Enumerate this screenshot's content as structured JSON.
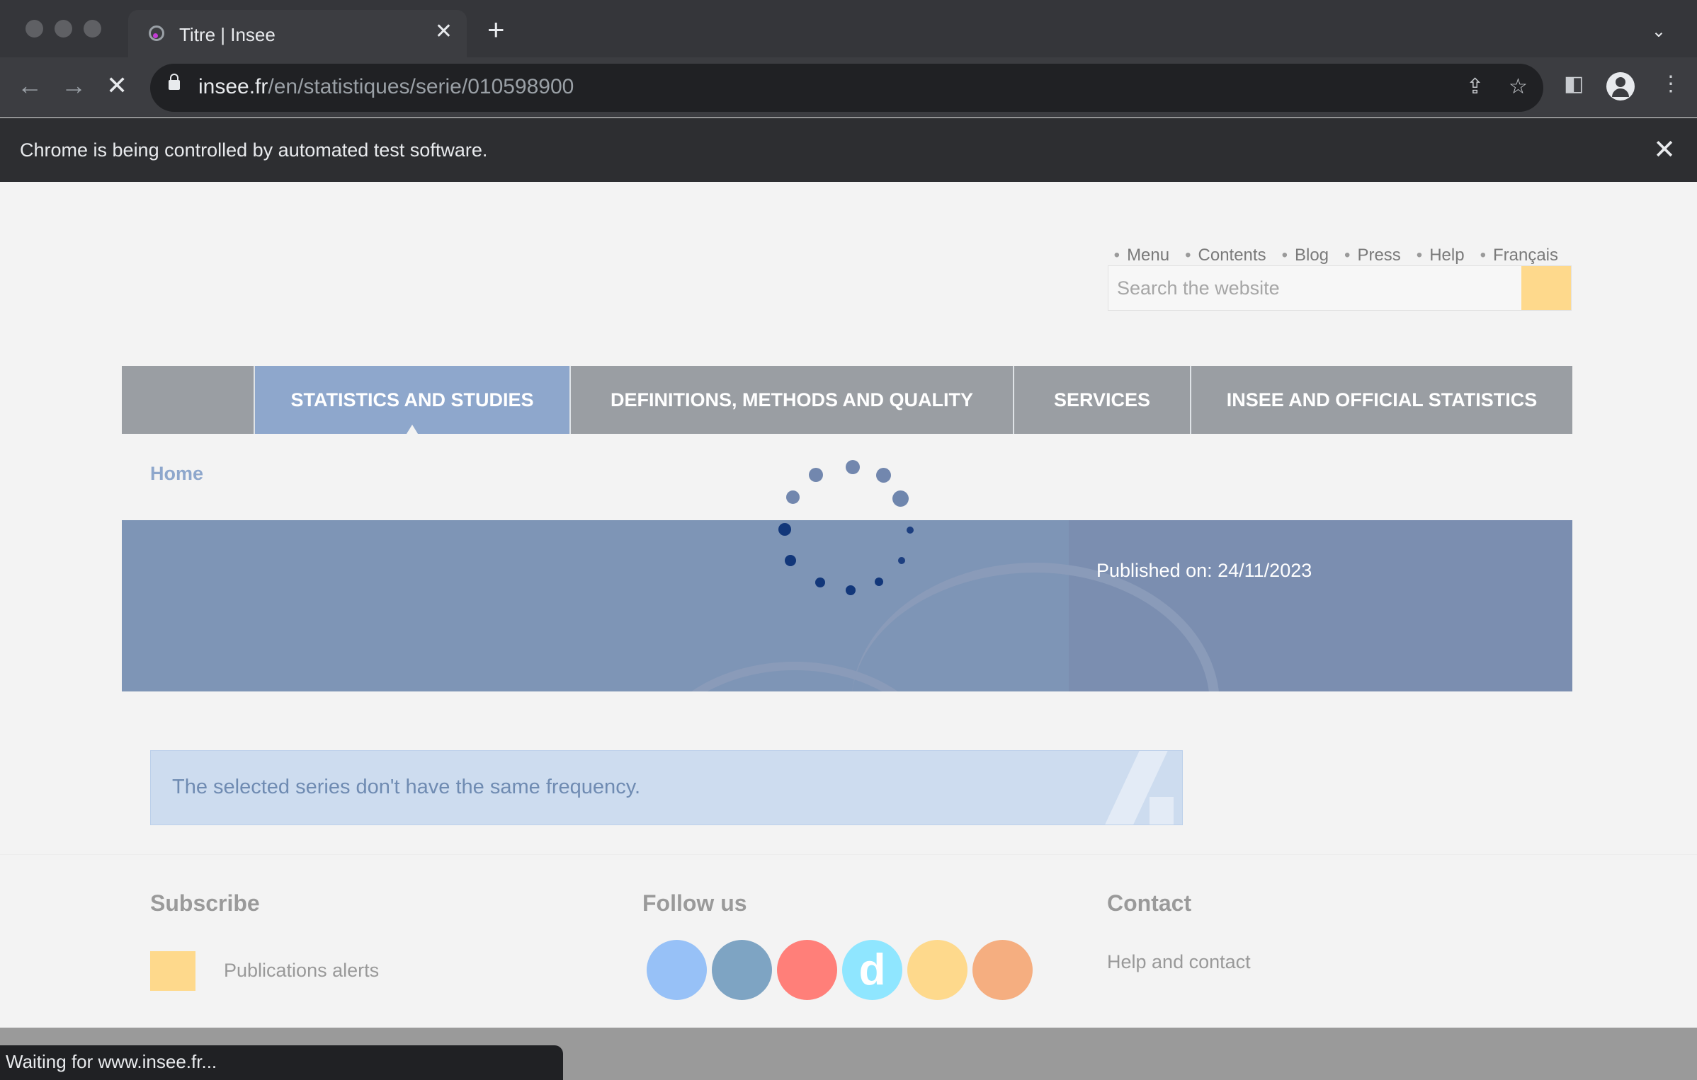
{
  "browser": {
    "tab_title": "Titre | Insee",
    "url_host": "insee.fr",
    "url_path": "/en/statistiques/serie/010598900",
    "infobar_text": "Chrome is being controlled by automated test software.",
    "status_text": "Waiting for www.insee.fr..."
  },
  "header": {
    "top_links": [
      "Menu",
      "Contents",
      "Blog",
      "Press",
      "Help",
      "Français"
    ],
    "search_placeholder": "Search the website"
  },
  "main_nav": {
    "items": [
      {
        "label": "STATISTICS AND STUDIES",
        "active": true
      },
      {
        "label": "DEFINITIONS, METHODS AND QUALITY",
        "active": false
      },
      {
        "label": "SERVICES",
        "active": false
      },
      {
        "label": "INSEE AND OFFICIAL STATISTICS",
        "active": false
      }
    ]
  },
  "breadcrumb": {
    "home": "Home"
  },
  "banner": {
    "published": "Published on: 24/11/2023"
  },
  "alert": {
    "message": "The selected series don't have the same frequency."
  },
  "footer": {
    "subscribe_title": "Subscribe",
    "subscribe_link": "Publications alerts",
    "follow_title": "Follow us",
    "social": [
      {
        "name": "twitter",
        "color": "#97c1f7",
        "glyph": ""
      },
      {
        "name": "linkedin",
        "color": "#7ea4c3",
        "glyph": ""
      },
      {
        "name": "youtube",
        "color": "#ff7f79",
        "glyph": ""
      },
      {
        "name": "dailymotion",
        "color": "#8fe6ff",
        "glyph": "d"
      },
      {
        "name": "rss",
        "color": "#fed98c",
        "glyph": ""
      },
      {
        "name": "blog",
        "color": "#f5ae80",
        "glyph": ""
      }
    ],
    "contact_title": "Contact",
    "contact_link": "Help and contact"
  },
  "colors": {
    "accent_blue": "#8ea7cc",
    "search_button": "#fed98c",
    "banner": "#7e95b6",
    "alert_bg": "#cddcef"
  }
}
